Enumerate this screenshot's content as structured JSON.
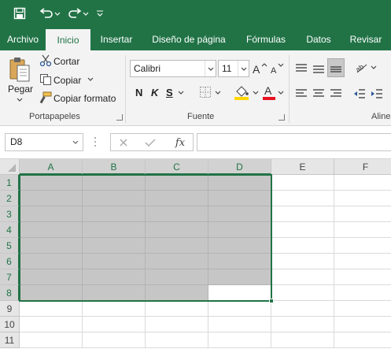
{
  "colors": {
    "brand": "#217346",
    "selection_fill": "#c6c6c6",
    "font_color_bar": "#e81123",
    "fill_color_bar": "#ffd700"
  },
  "quick_access": {
    "save_icon": "save-icon",
    "undo_icon": "undo-icon",
    "redo_icon": "redo-icon",
    "customize_icon": "customize-qat-icon"
  },
  "tabs": [
    "Archivo",
    "Inicio",
    "Insertar",
    "Diseño de página",
    "Fórmulas",
    "Datos",
    "Revisar"
  ],
  "clipboard": {
    "paste": "Pegar",
    "cut": "Cortar",
    "copy": "Copiar",
    "format_painter": "Copiar formato",
    "group": "Portapapeles"
  },
  "font": {
    "name": "Calibri",
    "size": "11",
    "bold": "N",
    "italic": "K",
    "underline": "S",
    "group": "Fuente"
  },
  "alignment": {
    "group": "Aline"
  },
  "formula_bar": {
    "name_box": "D8",
    "fx": "fx",
    "value": ""
  },
  "sheet": {
    "columns": [
      "A",
      "B",
      "C",
      "D",
      "E",
      "F"
    ],
    "rows": [
      "1",
      "2",
      "3",
      "4",
      "5",
      "6",
      "7",
      "8",
      "9",
      "10",
      "11"
    ],
    "active_cell": "D8",
    "selection": "A1:D8"
  }
}
